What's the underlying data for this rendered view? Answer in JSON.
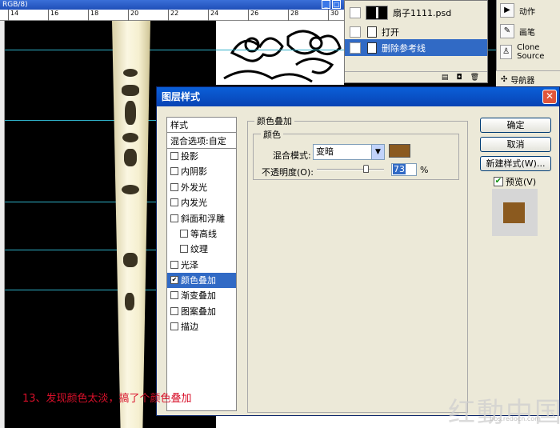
{
  "document": {
    "title_fragment": "RGB/8)",
    "ruler_ticks": [
      "14",
      "16",
      "18",
      "20",
      "22",
      "24",
      "26",
      "28",
      "30"
    ]
  },
  "history": {
    "snapshot": "扇子1111.psd",
    "steps": [
      {
        "label": "打开",
        "selected": false
      },
      {
        "label": "删除参考线",
        "selected": true
      }
    ]
  },
  "actions_panel": {
    "items": [
      {
        "label": "动作",
        "icon": "play-icon"
      },
      {
        "label": "画笔",
        "icon": "brush-icon"
      },
      {
        "label": "Clone Source",
        "icon": "clone-stamp-icon"
      }
    ],
    "navigator": "导航器"
  },
  "dialog": {
    "title": "图层样式",
    "style_header": "样式",
    "blend_options": "混合选项:自定",
    "styles": [
      {
        "label": "投影",
        "checked": false,
        "indent": false,
        "selected": false
      },
      {
        "label": "内阴影",
        "checked": false,
        "indent": false,
        "selected": false
      },
      {
        "label": "外发光",
        "checked": false,
        "indent": false,
        "selected": false
      },
      {
        "label": "内发光",
        "checked": false,
        "indent": false,
        "selected": false
      },
      {
        "label": "斜面和浮雕",
        "checked": false,
        "indent": false,
        "selected": false
      },
      {
        "label": "等高线",
        "checked": false,
        "indent": true,
        "selected": false
      },
      {
        "label": "纹理",
        "checked": false,
        "indent": true,
        "selected": false
      },
      {
        "label": "光泽",
        "checked": false,
        "indent": false,
        "selected": false
      },
      {
        "label": "颜色叠加",
        "checked": true,
        "indent": false,
        "selected": true
      },
      {
        "label": "渐变叠加",
        "checked": false,
        "indent": false,
        "selected": false
      },
      {
        "label": "图案叠加",
        "checked": false,
        "indent": false,
        "selected": false
      },
      {
        "label": "描边",
        "checked": false,
        "indent": false,
        "selected": false
      }
    ],
    "section_title": "颜色叠加",
    "subsection_title": "颜色",
    "blend_mode_label": "混合模式:",
    "blend_mode_value": "变暗",
    "overlay_color": "#8b5a1f",
    "opacity_label": "不透明度(O):",
    "opacity_value": "73",
    "opacity_unit": "%",
    "buttons": {
      "ok": "确定",
      "cancel": "取消",
      "new_style": "新建样式(W)..."
    },
    "preview_label": "预览(V)",
    "preview_checked": true
  },
  "caption": "13、发现颜色太淡，搞了个颜色叠加",
  "watermark": {
    "logo_text": "红動中国",
    "url": "bbs.redocn.com"
  }
}
